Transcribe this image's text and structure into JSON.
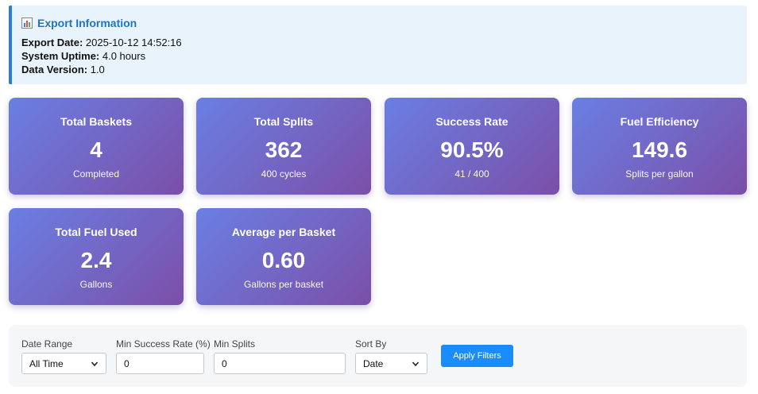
{
  "export_info": {
    "title": "Export Information",
    "icon": "bar-chart-icon",
    "lines": [
      {
        "label": "Export Date:",
        "value": "2025-10-12 14:52:16"
      },
      {
        "label": "System Uptime:",
        "value": "4.0 hours"
      },
      {
        "label": "Data Version:",
        "value": "1.0"
      }
    ]
  },
  "cards": [
    {
      "title": "Total Baskets",
      "value": "4",
      "sub": "Completed"
    },
    {
      "title": "Total Splits",
      "value": "362",
      "sub": "400 cycles"
    },
    {
      "title": "Success Rate",
      "value": "90.5%",
      "sub": "41 / 400"
    },
    {
      "title": "Fuel Efficiency",
      "value": "149.6",
      "sub": "Splits per gallon"
    },
    {
      "title": "Total Fuel Used",
      "value": "2.4",
      "sub": "Gallons"
    },
    {
      "title": "Average per Basket",
      "value": "0.60",
      "sub": "Gallons per basket"
    }
  ],
  "filters": {
    "date_range": {
      "label": "Date Range",
      "selected": "All Time"
    },
    "min_success_rate": {
      "label": "Min Success Rate (%)",
      "value": "0"
    },
    "min_splits": {
      "label": "Min Splits",
      "value": "0"
    },
    "sort_by": {
      "label": "Sort By",
      "selected": "Date"
    },
    "apply_label": "Apply Filters"
  },
  "colors": {
    "accent_blue": "#1f74c7",
    "card_gradient_start": "#6a7fe3",
    "card_gradient_end": "#7b4fa8",
    "button_blue": "#1a8cff"
  }
}
